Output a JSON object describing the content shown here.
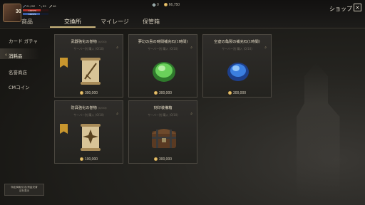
{
  "header": {
    "level": "30",
    "stats": [
      "21,292",
      "53",
      "46"
    ],
    "hp_text": "119/170",
    "mp_text": "115/171",
    "hp_fraction": 0.7,
    "mp_fraction": 0.67,
    "currency": {
      "gems": "0",
      "coins": "66,750"
    },
    "title": "ショップ",
    "close_glyph": "×"
  },
  "tabs": [
    {
      "label": "商品"
    },
    {
      "label": "交換所",
      "active": true
    },
    {
      "label": "マイレージ"
    },
    {
      "label": "保管箱"
    }
  ],
  "sidebar": {
    "items": [
      {
        "label": "カード ガチャ"
      },
      {
        "label": "消耗品",
        "active": true
      },
      {
        "label": "名誉商店"
      },
      {
        "label": "CMコイン"
      }
    ],
    "notice": "特定商取引法/資金決済\n法を表示"
  },
  "cards": [
    {
      "title": "武器強化の巻物",
      "limit": "(0/10)",
      "sub": "サーバー別 購入 (0/10)",
      "price": "300,000",
      "art": "scroll-sword",
      "banner": true
    },
    {
      "title": "夢幻の島の時間補充石(1時間)",
      "sub": "サーバー別 購入 (0/10)",
      "price": "300,000",
      "art": "green-stone"
    },
    {
      "title": "空虚の亀裂の補充石(1時間)",
      "sub": "サーバー別 購入 (0/10)",
      "price": "300,000",
      "art": "blue-stone"
    },
    {
      "title": "防具強化の巻物",
      "limit": "(0/10)",
      "sub": "サーバー別 購入 (0/10)",
      "price": "100,000",
      "art": "scroll-armor",
      "banner": true
    },
    {
      "title": "刻印装備箱",
      "sub": "サーバー別 購入 (0/10)",
      "price": "300,000",
      "art": "chest"
    }
  ],
  "colors": {
    "accent": "#c9b47c",
    "hp": "#b3302a",
    "mp": "#3a5fa8"
  }
}
